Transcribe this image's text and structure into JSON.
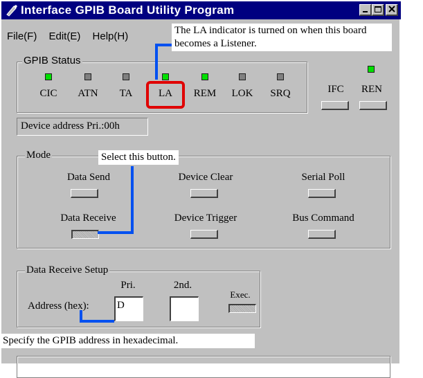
{
  "window": {
    "title": "Interface GPIB Board Utility Program"
  },
  "menu": {
    "file": "File(F)",
    "edit": "Edit(E)",
    "help": "Help(H)"
  },
  "status": {
    "group_label": "GPIB Status",
    "indicators": [
      {
        "label": "CIC",
        "state": "on"
      },
      {
        "label": "ATN",
        "state": "off"
      },
      {
        "label": "TA",
        "state": "off"
      },
      {
        "label": "LA",
        "state": "on"
      },
      {
        "label": "REM",
        "state": "on"
      },
      {
        "label": "LOK",
        "state": "off"
      },
      {
        "label": "SRQ",
        "state": "off"
      }
    ],
    "ifc_label": "IFC",
    "ren_label": "REN"
  },
  "device_address": "Device address Pri.:00h",
  "mode": {
    "group_label": "Mode",
    "buttons": {
      "data_send": "Data Send",
      "device_clear": "Device Clear",
      "serial_poll": "Serial Poll",
      "data_receive": "Data Receive",
      "device_trigger": "Device Trigger",
      "bus_command": "Bus Command"
    }
  },
  "receive_setup": {
    "group_label": "Data Receive Setup",
    "pri_label": "Pri.",
    "second_label": "2nd.",
    "exec_label": "Exec.",
    "address_label": "Address (hex):",
    "pri_value": "D",
    "second_value": ""
  },
  "callouts": {
    "la": "The LA indicator is turned on when this board becomes a Listener.",
    "select": "Select this button.",
    "address": "Specify the GPIB address in hexadecimal."
  },
  "colors": {
    "titlebar": "#000080",
    "led_on": "#00e000",
    "highlight": "#e00000",
    "callout_line": "#0050f0"
  }
}
